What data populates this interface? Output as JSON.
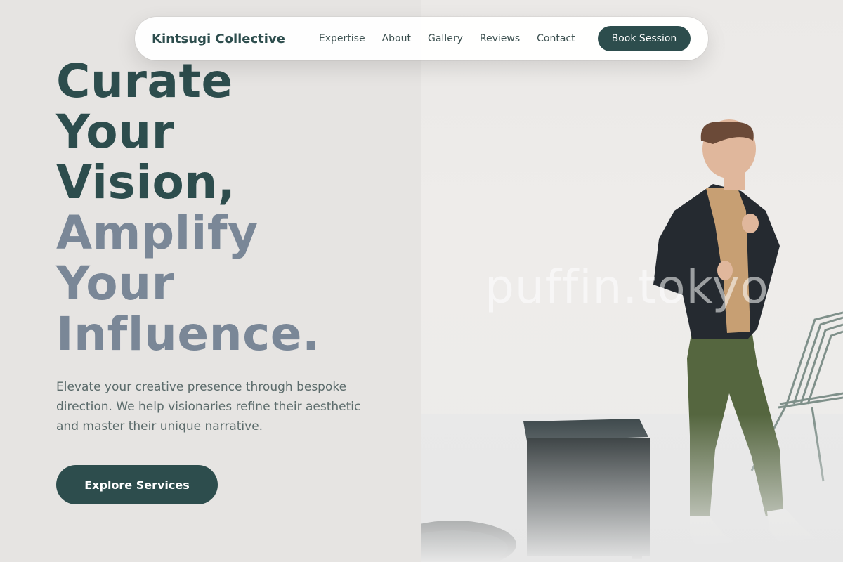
{
  "nav": {
    "brand": "Kintsugi Collective",
    "links": [
      "Expertise",
      "About",
      "Gallery",
      "Reviews",
      "Contact"
    ],
    "cta": "Book Session"
  },
  "hero": {
    "headline_dark": [
      "Curate",
      "Your",
      "Vision,"
    ],
    "headline_light": [
      "Amplify",
      "Your",
      "Influence."
    ],
    "lede": "Elevate your creative presence through bespoke direction. We help visionaries refine their aesthetic and master their unique narrative.",
    "cta": "Explore Services"
  },
  "photo": {
    "watermark": "puffin.tokyo"
  },
  "colors": {
    "primary": "#2d4d4d",
    "secondary_headline": "#7a8797",
    "background": "#e6e4e2"
  }
}
